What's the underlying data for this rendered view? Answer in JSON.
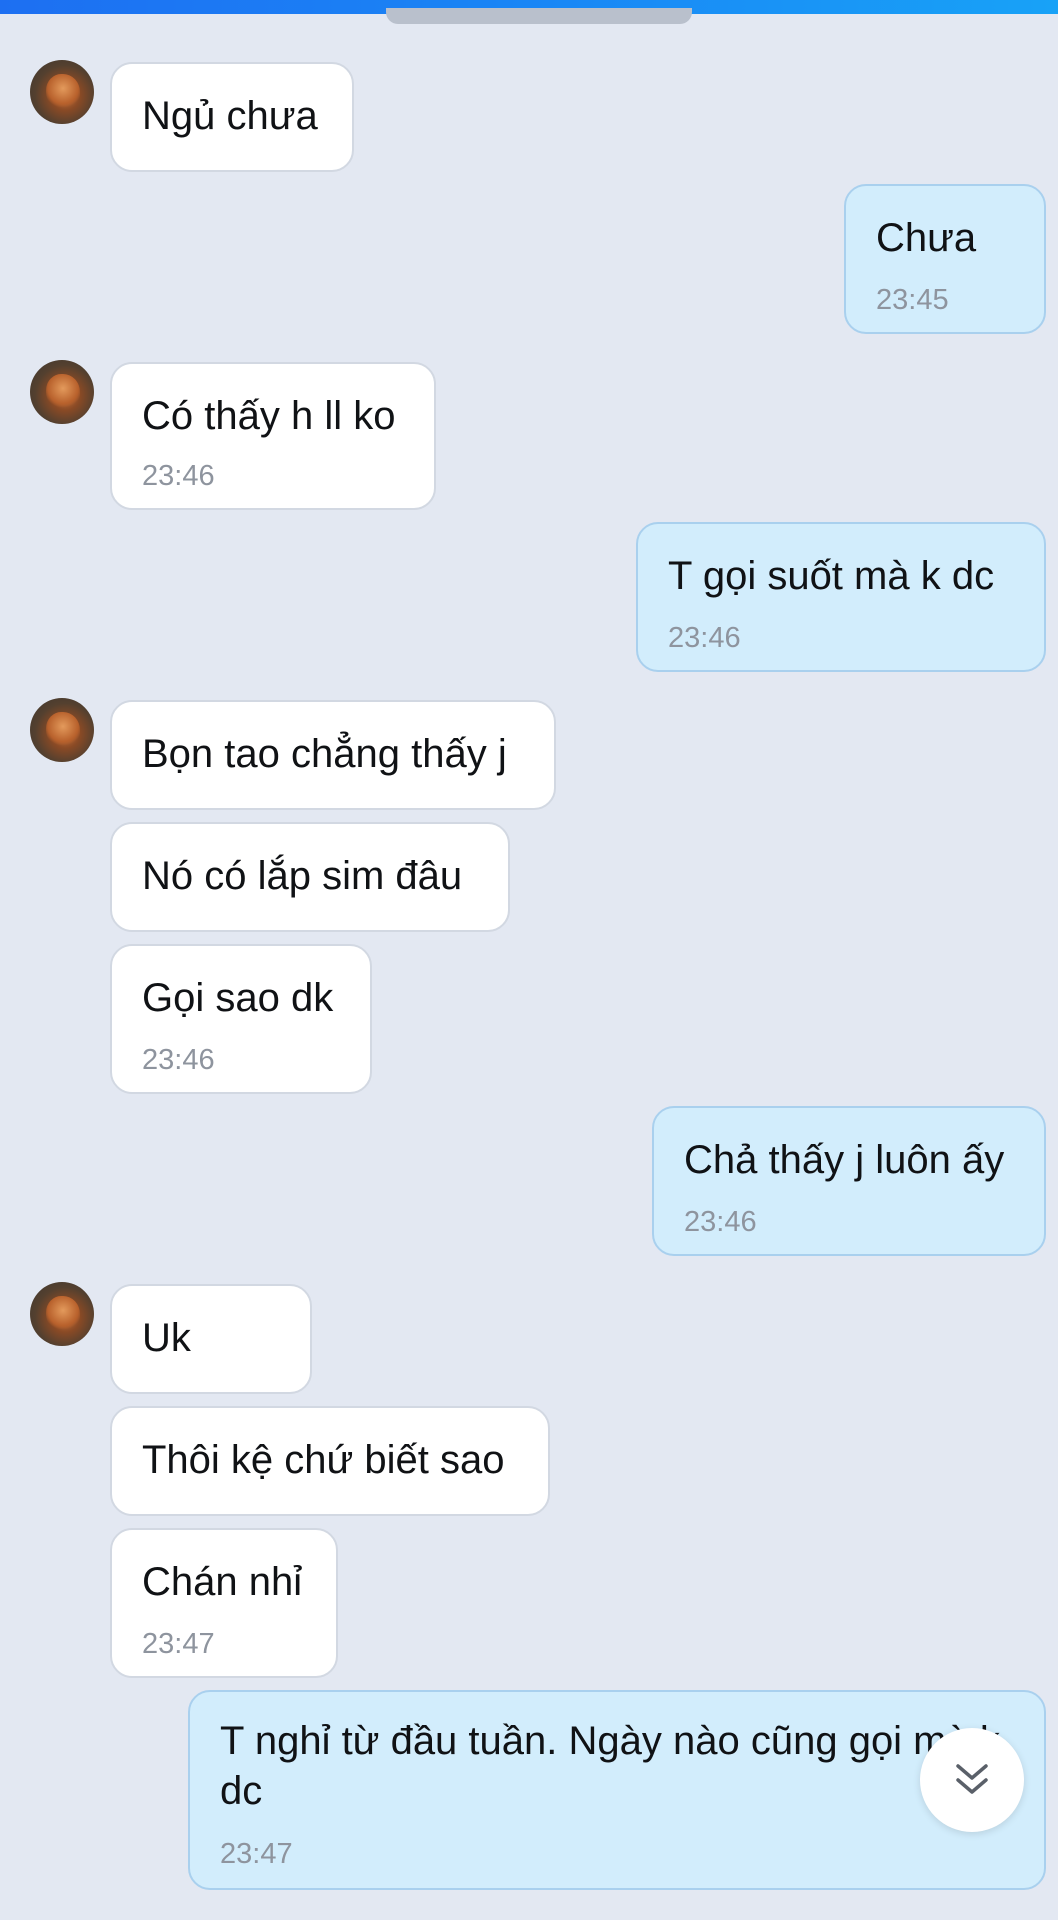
{
  "colors": {
    "background": "#e3e8f2",
    "incoming_bubble": "#ffffff",
    "outgoing_bubble": "#d2edfc",
    "top_bar": "#1a86f5",
    "timestamp": "#8e949e"
  },
  "icons": {
    "avatar": "contact-avatar",
    "scroll_down": "double-chevron-down-icon"
  },
  "messages": [
    {
      "direction": "in",
      "text": "Ngủ chưa",
      "time": ""
    },
    {
      "direction": "out",
      "text": "Chưa",
      "time": "23:45"
    },
    {
      "direction": "in",
      "text": "Có thấy h ll ko",
      "time": "23:46"
    },
    {
      "direction": "out",
      "text": "T gọi suốt mà k dc",
      "time": "23:46"
    },
    {
      "direction": "in",
      "text": "Bọn tao chẳng thấy j",
      "time": ""
    },
    {
      "direction": "in",
      "text": "Nó có lắp sim đâu",
      "time": ""
    },
    {
      "direction": "in",
      "text": "Gọi sao dk",
      "time": "23:46"
    },
    {
      "direction": "out",
      "text": "Chả thấy j luôn ấy",
      "time": "23:46"
    },
    {
      "direction": "in",
      "text": "Uk",
      "time": ""
    },
    {
      "direction": "in",
      "text": "Thôi kệ chứ biết sao",
      "time": ""
    },
    {
      "direction": "in",
      "text": "Chán nhỉ",
      "time": "23:47"
    },
    {
      "direction": "out",
      "text": "T nghỉ từ đầu tuần. Ngày nào cũng gọi mà k dc",
      "time": "23:47"
    }
  ]
}
